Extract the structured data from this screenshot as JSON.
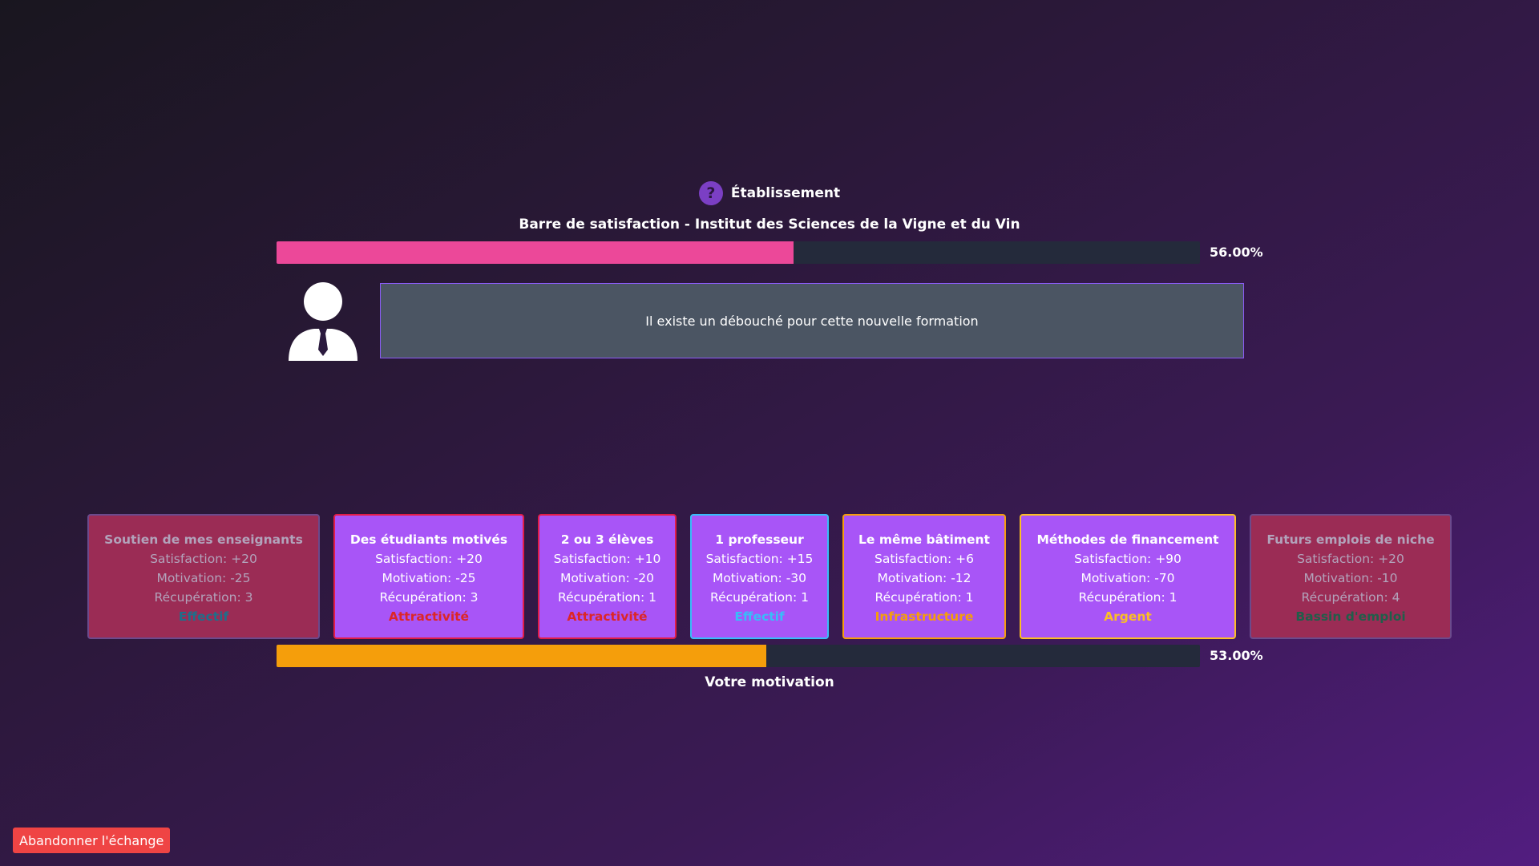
{
  "header": {
    "help_symbol": "?",
    "title": "Établissement"
  },
  "satisfaction": {
    "title": "Barre de satisfaction - Institut des Sciences de la Vigne et du Vin",
    "percent": 56.0,
    "percent_label": "56.00%",
    "color": "#ec4899"
  },
  "dialogue": {
    "avatar_icon": "businessman-icon",
    "message": "Il existe un débouché pour cette nouvelle formation"
  },
  "cards": [
    {
      "title": "Soutien de mes enseignants",
      "satisfaction": "Satisfaction: +20",
      "motivation": "Motivation: -25",
      "recuperation": "Récupération: 3",
      "type": "Effectif",
      "type_color": "#1e6f8a",
      "border_color": "#6b4a8c",
      "state": "disabled",
      "width": 290
    },
    {
      "title": "Des étudiants motivés",
      "satisfaction": "Satisfaction: +20",
      "motivation": "Motivation: -25",
      "recuperation": "Récupération: 3",
      "type": "Attractivité",
      "type_color": "#dc2626",
      "border_color": "#e11d48",
      "state": "active",
      "width": 238
    },
    {
      "title": "2 ou 3 élèves",
      "satisfaction": "Satisfaction: +10",
      "motivation": "Motivation: -20",
      "recuperation": "Récupération: 1",
      "type": "Attractivité",
      "type_color": "#dc2626",
      "border_color": "#e11d48",
      "state": "active",
      "width": 173
    },
    {
      "title": "1 professeur",
      "satisfaction": "Satisfaction: +15",
      "motivation": "Motivation: -30",
      "recuperation": "Récupération: 1",
      "type": "Effectif",
      "type_color": "#38bdf8",
      "border_color": "#38bdf8",
      "state": "active",
      "width": 173
    },
    {
      "title": "Le même bâtiment",
      "satisfaction": "Satisfaction: +6",
      "motivation": "Motivation: -12",
      "recuperation": "Récupération: 1",
      "type": "Infrastructure",
      "type_color": "#f59e0b",
      "border_color": "#f59e0b",
      "state": "active",
      "width": 204
    },
    {
      "title": "Méthodes de financement",
      "satisfaction": "Satisfaction: +90",
      "motivation": "Motivation: -70",
      "recuperation": "Récupération: 1",
      "type": "Argent",
      "type_color": "#fbbf24",
      "border_color": "#fbbf24",
      "state": "active",
      "width": 270
    },
    {
      "title": "Futurs emplois de niche",
      "satisfaction": "Satisfaction: +20",
      "motivation": "Motivation: -10",
      "recuperation": "Récupération: 4",
      "type": "Bassin d'emploi",
      "type_color": "#1f5f4a",
      "border_color": "#6b4a8c",
      "state": "disabled",
      "width": 252
    }
  ],
  "motivation": {
    "label": "Votre motivation",
    "percent": 53.0,
    "percent_label": "53.00%",
    "color": "#f59e0b"
  },
  "footer": {
    "abandon_label": "Abandonner l'échange"
  }
}
